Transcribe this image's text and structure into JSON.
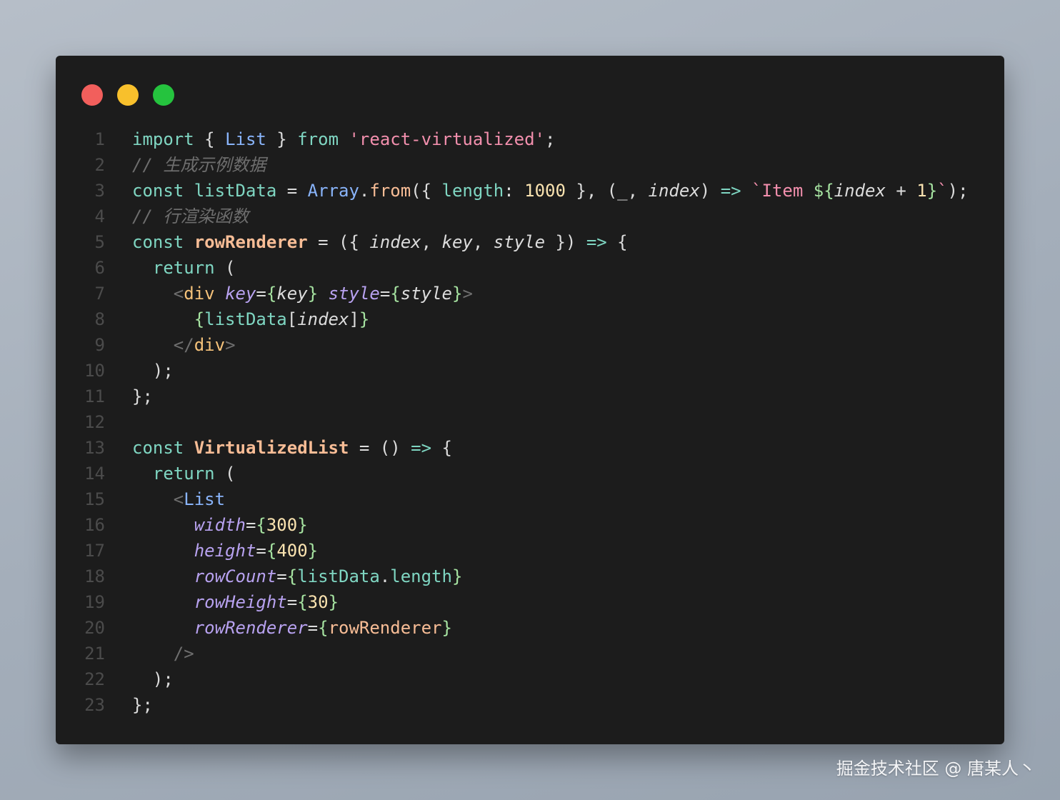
{
  "colors": {
    "page_background": "#a4aeba",
    "editor_background": "#1c1c1c",
    "line_number": "#4b4b4b",
    "keyword": "#7fd6c2",
    "comment": "#6e6e6e",
    "string": "#f28fad",
    "type": "#89b4fa",
    "function": "#f8bd96",
    "number": "#fae3b0",
    "attribute": "#b8a2f0",
    "jsx_tag": "#f5c27a",
    "brace": "#a6e3a1",
    "operator": "#8bd5ff",
    "punctuation": "#dcdcdc"
  },
  "window": {
    "buttons": [
      {
        "name": "close",
        "color": "#f25f5c"
      },
      {
        "name": "minimize",
        "color": "#f8c02c"
      },
      {
        "name": "maximize",
        "color": "#25c33e"
      }
    ]
  },
  "code": {
    "lines": [
      {
        "number": "1",
        "tokens": [
          {
            "text": "import",
            "kind": "keyword"
          },
          {
            "text": " { ",
            "kind": "punctuation"
          },
          {
            "text": "List",
            "kind": "type"
          },
          {
            "text": " } ",
            "kind": "punctuation"
          },
          {
            "text": "from",
            "kind": "keyword"
          },
          {
            "text": " ",
            "kind": "punctuation"
          },
          {
            "text": "'react-virtualized'",
            "kind": "string"
          },
          {
            "text": ";",
            "kind": "punctuation"
          }
        ]
      },
      {
        "number": "2",
        "tokens": [
          {
            "text": "// 生成示例数据",
            "kind": "comment",
            "italic": true
          }
        ]
      },
      {
        "number": "3",
        "tokens": [
          {
            "text": "const",
            "kind": "keyword"
          },
          {
            "text": " ",
            "kind": "punctuation"
          },
          {
            "text": "listData",
            "kind": "keyword"
          },
          {
            "text": " = ",
            "kind": "punctuation"
          },
          {
            "text": "Array",
            "kind": "type"
          },
          {
            "text": ".",
            "kind": "punctuation"
          },
          {
            "text": "from",
            "kind": "function"
          },
          {
            "text": "({ ",
            "kind": "punctuation"
          },
          {
            "text": "length",
            "kind": "keyword"
          },
          {
            "text": ": ",
            "kind": "punctuation"
          },
          {
            "text": "1000",
            "kind": "number"
          },
          {
            "text": " }, (",
            "kind": "punctuation"
          },
          {
            "text": "_",
            "kind": "punctuation"
          },
          {
            "text": ", ",
            "kind": "punctuation"
          },
          {
            "text": "index",
            "kind": "punctuation",
            "italic": true
          },
          {
            "text": ") ",
            "kind": "punctuation"
          },
          {
            "text": "=>",
            "kind": "keyword"
          },
          {
            "text": " ",
            "kind": "punctuation"
          },
          {
            "text": "`Item ",
            "kind": "string"
          },
          {
            "text": "${",
            "kind": "brace"
          },
          {
            "text": "index",
            "kind": "punctuation",
            "italic": true
          },
          {
            "text": " + ",
            "kind": "punctuation"
          },
          {
            "text": "1",
            "kind": "number"
          },
          {
            "text": "}",
            "kind": "brace"
          },
          {
            "text": "`",
            "kind": "string"
          },
          {
            "text": ");",
            "kind": "punctuation"
          }
        ]
      },
      {
        "number": "4",
        "tokens": [
          {
            "text": "// 行渲染函数",
            "kind": "comment",
            "italic": true
          }
        ]
      },
      {
        "number": "5",
        "tokens": [
          {
            "text": "const",
            "kind": "keyword"
          },
          {
            "text": " ",
            "kind": "punctuation"
          },
          {
            "text": "rowRenderer",
            "kind": "function",
            "bold": true
          },
          {
            "text": " = ({ ",
            "kind": "punctuation"
          },
          {
            "text": "index",
            "kind": "punctuation",
            "italic": true
          },
          {
            "text": ", ",
            "kind": "punctuation"
          },
          {
            "text": "key",
            "kind": "punctuation",
            "italic": true
          },
          {
            "text": ", ",
            "kind": "punctuation"
          },
          {
            "text": "style",
            "kind": "punctuation",
            "italic": true
          },
          {
            "text": " }) ",
            "kind": "punctuation"
          },
          {
            "text": "=>",
            "kind": "keyword"
          },
          {
            "text": " {",
            "kind": "punctuation"
          }
        ]
      },
      {
        "number": "6",
        "tokens": [
          {
            "text": "  ",
            "kind": "punctuation"
          },
          {
            "text": "return",
            "kind": "keyword"
          },
          {
            "text": " (",
            "kind": "punctuation"
          }
        ]
      },
      {
        "number": "7",
        "tokens": [
          {
            "text": "    <",
            "kind": "comment"
          },
          {
            "text": "div",
            "kind": "jsx_tag"
          },
          {
            "text": " ",
            "kind": "punctuation"
          },
          {
            "text": "key",
            "kind": "attribute",
            "italic": true
          },
          {
            "text": "=",
            "kind": "punctuation"
          },
          {
            "text": "{",
            "kind": "brace"
          },
          {
            "text": "key",
            "kind": "punctuation",
            "italic": true
          },
          {
            "text": "}",
            "kind": "brace"
          },
          {
            "text": " ",
            "kind": "punctuation"
          },
          {
            "text": "style",
            "kind": "attribute",
            "italic": true
          },
          {
            "text": "=",
            "kind": "punctuation"
          },
          {
            "text": "{",
            "kind": "brace"
          },
          {
            "text": "style",
            "kind": "punctuation",
            "italic": true
          },
          {
            "text": "}",
            "kind": "brace"
          },
          {
            "text": ">",
            "kind": "comment"
          }
        ]
      },
      {
        "number": "8",
        "tokens": [
          {
            "text": "      ",
            "kind": "punctuation"
          },
          {
            "text": "{",
            "kind": "brace"
          },
          {
            "text": "listData",
            "kind": "keyword"
          },
          {
            "text": "[",
            "kind": "punctuation"
          },
          {
            "text": "index",
            "kind": "punctuation",
            "italic": true
          },
          {
            "text": "]",
            "kind": "punctuation"
          },
          {
            "text": "}",
            "kind": "brace"
          }
        ]
      },
      {
        "number": "9",
        "tokens": [
          {
            "text": "    </",
            "kind": "comment"
          },
          {
            "text": "div",
            "kind": "jsx_tag"
          },
          {
            "text": ">",
            "kind": "comment"
          }
        ]
      },
      {
        "number": "10",
        "tokens": [
          {
            "text": "  );",
            "kind": "punctuation"
          }
        ]
      },
      {
        "number": "11",
        "tokens": [
          {
            "text": "};",
            "kind": "punctuation"
          }
        ]
      },
      {
        "number": "12",
        "tokens": []
      },
      {
        "number": "13",
        "tokens": [
          {
            "text": "const",
            "kind": "keyword"
          },
          {
            "text": " ",
            "kind": "punctuation"
          },
          {
            "text": "VirtualizedList",
            "kind": "function",
            "bold": true
          },
          {
            "text": " = () ",
            "kind": "punctuation"
          },
          {
            "text": "=>",
            "kind": "keyword"
          },
          {
            "text": " {",
            "kind": "punctuation"
          }
        ]
      },
      {
        "number": "14",
        "tokens": [
          {
            "text": "  ",
            "kind": "punctuation"
          },
          {
            "text": "return",
            "kind": "keyword"
          },
          {
            "text": " (",
            "kind": "punctuation"
          }
        ]
      },
      {
        "number": "15",
        "tokens": [
          {
            "text": "    <",
            "kind": "comment"
          },
          {
            "text": "List",
            "kind": "type"
          }
        ]
      },
      {
        "number": "16",
        "tokens": [
          {
            "text": "      ",
            "kind": "punctuation"
          },
          {
            "text": "width",
            "kind": "attribute",
            "italic": true
          },
          {
            "text": "=",
            "kind": "punctuation"
          },
          {
            "text": "{",
            "kind": "brace"
          },
          {
            "text": "300",
            "kind": "number"
          },
          {
            "text": "}",
            "kind": "brace"
          }
        ]
      },
      {
        "number": "17",
        "tokens": [
          {
            "text": "      ",
            "kind": "punctuation"
          },
          {
            "text": "height",
            "kind": "attribute",
            "italic": true
          },
          {
            "text": "=",
            "kind": "punctuation"
          },
          {
            "text": "{",
            "kind": "brace"
          },
          {
            "text": "400",
            "kind": "number"
          },
          {
            "text": "}",
            "kind": "brace"
          }
        ]
      },
      {
        "number": "18",
        "tokens": [
          {
            "text": "      ",
            "kind": "punctuation"
          },
          {
            "text": "rowCount",
            "kind": "attribute",
            "italic": true
          },
          {
            "text": "=",
            "kind": "punctuation"
          },
          {
            "text": "{",
            "kind": "brace"
          },
          {
            "text": "listData",
            "kind": "keyword"
          },
          {
            "text": ".",
            "kind": "punctuation"
          },
          {
            "text": "length",
            "kind": "keyword"
          },
          {
            "text": "}",
            "kind": "brace"
          }
        ]
      },
      {
        "number": "19",
        "tokens": [
          {
            "text": "      ",
            "kind": "punctuation"
          },
          {
            "text": "rowHeight",
            "kind": "attribute",
            "italic": true
          },
          {
            "text": "=",
            "kind": "punctuation"
          },
          {
            "text": "{",
            "kind": "brace"
          },
          {
            "text": "30",
            "kind": "number"
          },
          {
            "text": "}",
            "kind": "brace"
          }
        ]
      },
      {
        "number": "20",
        "tokens": [
          {
            "text": "      ",
            "kind": "punctuation"
          },
          {
            "text": "rowRenderer",
            "kind": "attribute",
            "italic": true
          },
          {
            "text": "=",
            "kind": "punctuation"
          },
          {
            "text": "{",
            "kind": "brace"
          },
          {
            "text": "rowRenderer",
            "kind": "function"
          },
          {
            "text": "}",
            "kind": "brace"
          }
        ]
      },
      {
        "number": "21",
        "tokens": [
          {
            "text": "    />",
            "kind": "comment"
          }
        ]
      },
      {
        "number": "22",
        "tokens": [
          {
            "text": "  );",
            "kind": "punctuation"
          }
        ]
      },
      {
        "number": "23",
        "tokens": [
          {
            "text": "};",
            "kind": "punctuation"
          }
        ]
      }
    ]
  },
  "watermark": {
    "text": "掘金技术社区 @ 唐某人丶"
  }
}
